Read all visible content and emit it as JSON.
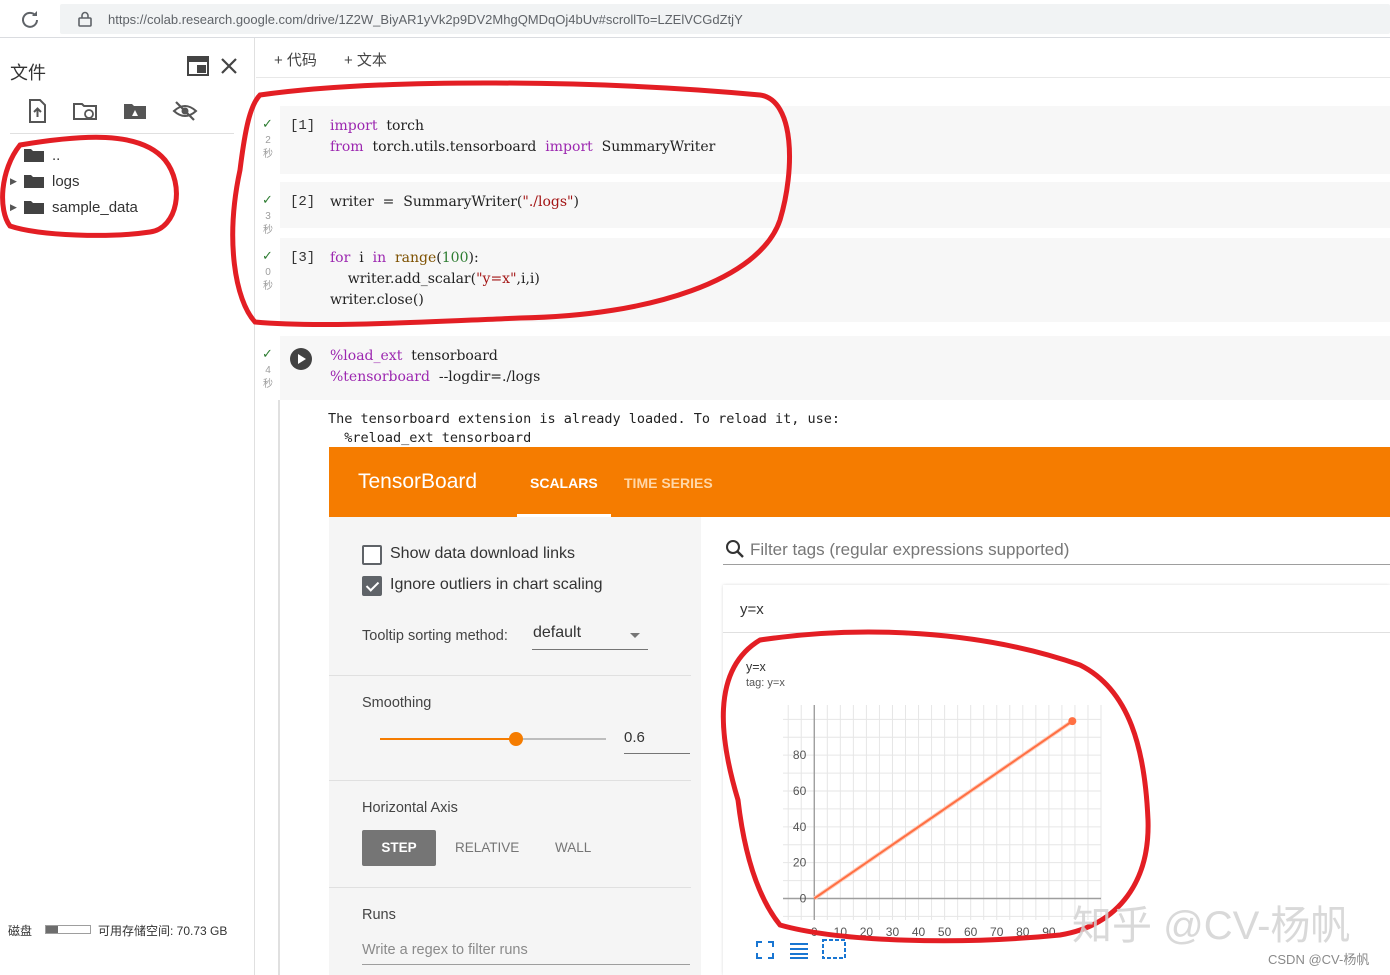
{
  "browser": {
    "url": "https://colab.research.google.com/drive/1Z2W_BiyAR1yVk2p9DV2MhgQMDqOj4bUv#scrollTo=LZElVCGdZtjY"
  },
  "sidebar": {
    "title": "文件",
    "tree": [
      {
        "label": ".."
      },
      {
        "label": "logs"
      },
      {
        "label": "sample_data"
      }
    ],
    "disk": {
      "label": "磁盘",
      "free_text": "可用存储空间: 70.73 GB",
      "used_fraction": 0.28
    }
  },
  "toolbar": {
    "add_code": "+ 代码",
    "add_text": "+ 文本"
  },
  "cells": [
    {
      "prompt": "[1]",
      "time": [
        "2",
        "秒"
      ]
    },
    {
      "prompt": "[2]",
      "time": [
        "3",
        "秒"
      ]
    },
    {
      "prompt": "[3]",
      "time": [
        "0",
        "秒"
      ]
    },
    {
      "prompt": "",
      "time": [
        "4",
        "秒"
      ]
    }
  ],
  "code": {
    "c1_l1_kw": "import",
    "c1_l1_rest": "  torch",
    "c1_l2_kw": "from",
    "c1_l2_mod": "  torch.utils.tensorboard  ",
    "c1_l2_kw2": "import",
    "c1_l2_rest": "  SummaryWriter",
    "c2_l1_a": "writer  =  SummaryWriter(",
    "c2_l1_str": "\"./logs\"",
    "c2_l1_b": ")",
    "c3_l1_kw": "for",
    "c3_l1_a": "  i  ",
    "c3_l1_kw2": "in",
    "c3_l1_bi": "  range",
    "c3_l1_b": "(",
    "c3_l1_num": "100",
    "c3_l1_c": "):",
    "c3_l2_a": "    writer.add_scalar(",
    "c3_l2_str": "\"y=x\"",
    "c3_l2_b": ",i,i)",
    "c3_l3": "writer.close()",
    "c4_l1_kw": "%load_ext",
    "c4_l1_rest": "  tensorboard",
    "c4_l2_kw": "%tensorboard",
    "c4_l2_rest": "  --logdir=./logs"
  },
  "output": {
    "line1": "The tensorboard extension is already loaded. To reload it, use:",
    "line2": "  %reload_ext tensorboard"
  },
  "tensorboard": {
    "logo": "TensorBoard",
    "tabs": [
      "SCALARS",
      "TIME SERIES"
    ],
    "show_download": "Show data download links",
    "ignore_outliers": "Ignore outliers in chart scaling",
    "tooltip_label": "Tooltip sorting method:",
    "tooltip_value": "default",
    "smoothing_label": "Smoothing",
    "smoothing_value": "0.6",
    "smoothing_fraction": 0.6,
    "haxis_label": "Horizontal Axis",
    "haxis_options": [
      "STEP",
      "RELATIVE",
      "WALL"
    ],
    "runs_label": "Runs",
    "runs_placeholder": "Write a regex to filter runs",
    "filter_placeholder": "Filter tags (regular expressions supported)",
    "card_title": "y=x"
  },
  "chart_data": {
    "type": "line",
    "title": "y=x",
    "subtitle": "tag: y=x",
    "x": [
      0,
      99
    ],
    "series": [
      {
        "values": [
          0,
          99
        ]
      }
    ],
    "xlim": [
      -12,
      110
    ],
    "ylim": [
      -12,
      108
    ],
    "xticks": [
      0,
      10,
      20,
      30,
      40,
      50,
      60,
      70,
      80,
      90
    ],
    "yticks": [
      0,
      20,
      40,
      60,
      80
    ],
    "grid": true,
    "color": "#ff7043"
  },
  "watermark": {
    "main": "知乎 @CV-杨帆",
    "csdn": "CSDN @CV-杨帆"
  }
}
